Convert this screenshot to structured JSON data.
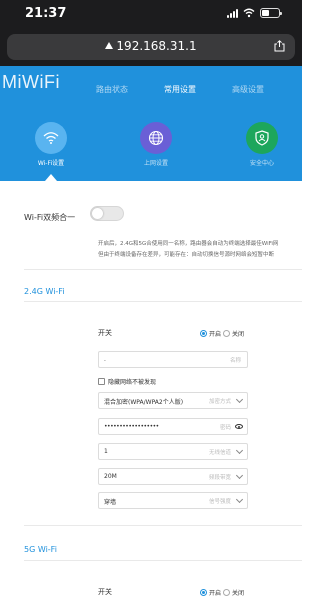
{
  "status_bar": {
    "time": "21:37"
  },
  "browser": {
    "url": "192.168.31.1"
  },
  "app": {
    "logo": "MiWiFi",
    "nav": [
      {
        "label": "路由状态",
        "active": false
      },
      {
        "label": "常用设置",
        "active": true
      },
      {
        "label": "高级设置",
        "active": false
      }
    ],
    "subnav": [
      {
        "label": "Wi-Fi设置",
        "icon": "wifi-icon",
        "color": "#59b4f0",
        "active": true
      },
      {
        "label": "上网设置",
        "icon": "globe-icon",
        "color": "#6a5fd6",
        "active": false
      },
      {
        "label": "安全中心",
        "icon": "shield-icon",
        "color": "#1da65c",
        "active": false
      }
    ]
  },
  "dual_band": {
    "label": "Wi-Fi双频合一",
    "enabled": false,
    "description_line1": "开启后，2.4G和5G合使用同一名称，路由器会自动为终端选择最佳WiFi网",
    "description_line2": "但由于终端设备存在差异，可能存在：自动切换信号源时网络会短暂中断"
  },
  "band_24": {
    "title": "2.4G Wi-Fi",
    "switch_label": "开关",
    "radio_on": "开启",
    "radio_off": "关闭",
    "ssid_value": ".",
    "ssid_hint": "名称",
    "hide_label": "隐藏网络不被发现",
    "encryption_value": "混合加密(WPA/WPA2个人版)",
    "encryption_hint": "加密方式",
    "password_value": "••••••••••••••••••",
    "password_hint": "密码",
    "channel_value": "1",
    "channel_hint": "无线信道",
    "bandwidth_value": "20M",
    "bandwidth_hint": "频段带宽",
    "signal_value": "穿墙",
    "signal_hint": "信号强度"
  },
  "band_5": {
    "title": "5G Wi-Fi",
    "switch_label": "开关",
    "radio_on": "开启",
    "radio_off": "关闭"
  }
}
